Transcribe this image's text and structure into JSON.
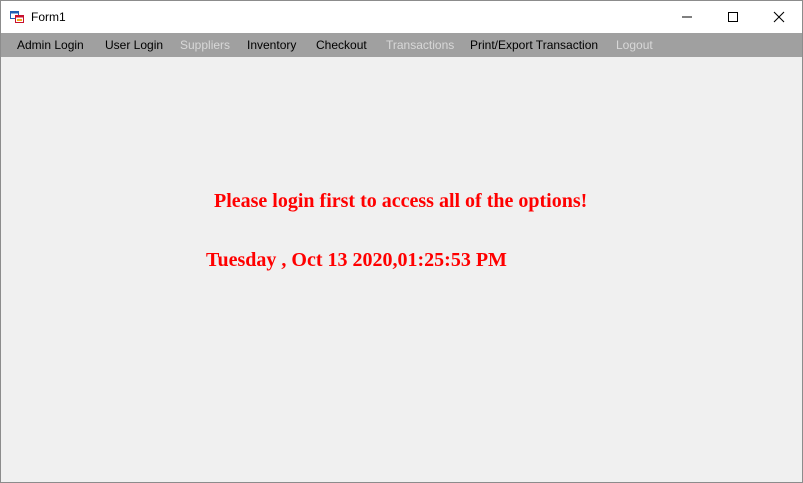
{
  "window": {
    "title": "Form1"
  },
  "menu": {
    "items": [
      {
        "label": "Admin Login",
        "enabled": true
      },
      {
        "label": "User Login",
        "enabled": true
      },
      {
        "label": "Suppliers",
        "enabled": false
      },
      {
        "label": "Inventory",
        "enabled": true
      },
      {
        "label": "Checkout",
        "enabled": true
      },
      {
        "label": "Transactions",
        "enabled": false
      },
      {
        "label": "Print/Export Transaction",
        "enabled": true
      },
      {
        "label": "Logout",
        "enabled": false
      }
    ]
  },
  "main": {
    "login_message": "Please login first to access all of the options!",
    "datetime": "Tuesday , Oct 13 2020,01:25:53 PM"
  },
  "colors": {
    "message": "#ff0000",
    "menubar": "#a0a0a0",
    "background": "#f0f0f0"
  },
  "icons": {
    "app": "form-icon",
    "minimize": "minimize-icon",
    "maximize": "maximize-icon",
    "close": "close-icon"
  }
}
